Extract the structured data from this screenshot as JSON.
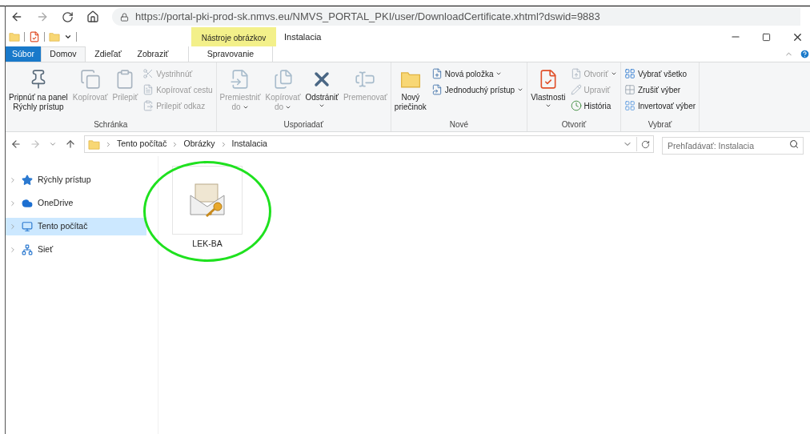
{
  "browser": {
    "url": "https://portal-pki-prod-sk.nmvs.eu/NMVS_PORTAL_PKI/user/DownloadCertificate.xhtml?dswid=9883"
  },
  "title_bar": {
    "context_label": "Nástroje obrázkov",
    "title": "Instalacia"
  },
  "tabs": [
    {
      "label": "Súbor",
      "kind": "file",
      "selected": false
    },
    {
      "label": "Domov",
      "kind": "normal",
      "selected": true
    },
    {
      "label": "Zdieľať",
      "kind": "normal",
      "selected": false
    },
    {
      "label": "Zobraziť",
      "kind": "normal",
      "selected": false
    },
    {
      "label": "Spravovanie",
      "kind": "context",
      "selected": false
    }
  ],
  "ribbon": [
    {
      "label": "Schránka",
      "columns": [
        {
          "kind": "large",
          "lines": [
            "Pripnúť na panel",
            "Rýchly prístup"
          ],
          "disabled": false,
          "dropdown": false
        },
        {
          "kind": "large",
          "lines": [
            "Kopírovať"
          ],
          "disabled": true,
          "dropdown": false
        },
        {
          "kind": "large",
          "lines": [
            "Prilepiť"
          ],
          "disabled": true,
          "dropdown": false
        },
        {
          "kind": "stack",
          "items": [
            {
              "label": "Vystrihnúť",
              "disabled": true,
              "dropdown": false
            },
            {
              "label": "Kopírovať cestu",
              "disabled": true,
              "dropdown": false
            },
            {
              "label": "Prilepiť odkaz",
              "disabled": true,
              "dropdown": false
            }
          ]
        }
      ]
    },
    {
      "label": "Usporiadať",
      "columns": [
        {
          "kind": "large",
          "lines": [
            "Premiestniť",
            "do"
          ],
          "disabled": true,
          "dropdown": true
        },
        {
          "kind": "large",
          "lines": [
            "Kopírovať",
            "do"
          ],
          "disabled": true,
          "dropdown": true
        },
        {
          "kind": "large",
          "lines": [
            "Odstrániť"
          ],
          "disabled": false,
          "dropdown": true
        },
        {
          "kind": "large",
          "lines": [
            "Premenovať"
          ],
          "disabled": true,
          "dropdown": false
        }
      ]
    },
    {
      "label": "Nové",
      "columns": [
        {
          "kind": "large",
          "lines": [
            "Nový",
            "priečinok"
          ],
          "disabled": false,
          "dropdown": false
        },
        {
          "kind": "stack",
          "items": [
            {
              "label": "Nová položka",
              "disabled": false,
              "dropdown": true
            },
            {
              "label": "Jednoduchý prístup",
              "disabled": false,
              "dropdown": true
            }
          ]
        }
      ]
    },
    {
      "label": "Otvoriť",
      "columns": [
        {
          "kind": "large",
          "lines": [
            "Vlastnosti"
          ],
          "disabled": false,
          "dropdown": true
        },
        {
          "kind": "stack",
          "items": [
            {
              "label": "Otvoriť",
              "disabled": true,
              "dropdown": true
            },
            {
              "label": "Upraviť",
              "disabled": true,
              "dropdown": false
            },
            {
              "label": "História",
              "disabled": false,
              "dropdown": false
            }
          ]
        }
      ]
    },
    {
      "label": "Vybrať",
      "columns": [
        {
          "kind": "stack",
          "items": [
            {
              "label": "Vybrať všetko",
              "disabled": false,
              "dropdown": false
            },
            {
              "label": "Zrušiť výber",
              "disabled": false,
              "dropdown": false
            },
            {
              "label": "Invertovať výber",
              "disabled": false,
              "dropdown": false
            }
          ]
        }
      ]
    }
  ],
  "address": {
    "path": [
      "Tento počítač",
      "Obrázky",
      "Instalacia"
    ],
    "search_placeholder": "Prehľadávať: Instalacia"
  },
  "sidebar": {
    "items": [
      {
        "label": "Rýchly prístup",
        "selected": false
      },
      {
        "label": "OneDrive",
        "selected": false
      },
      {
        "label": "Tento počítač",
        "selected": true
      },
      {
        "label": "Sieť",
        "selected": false
      }
    ]
  },
  "files": [
    {
      "name": "LEK-BA",
      "highlighted": true
    }
  ]
}
